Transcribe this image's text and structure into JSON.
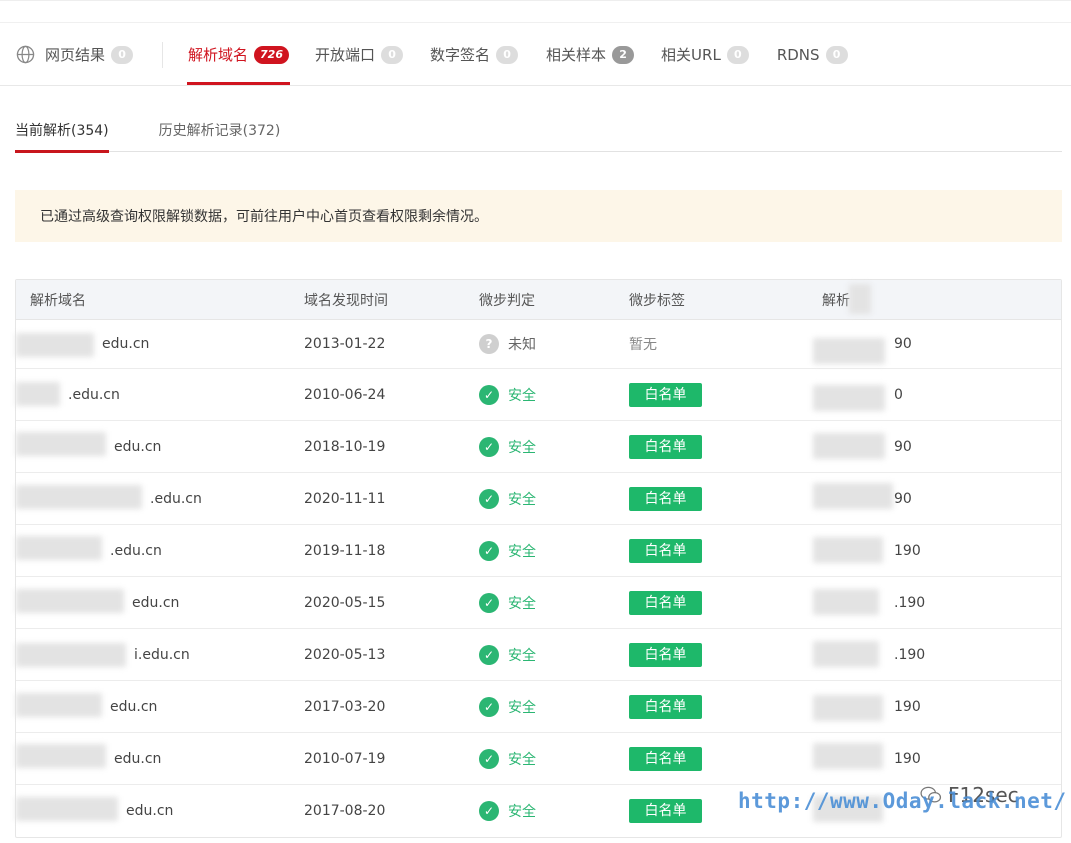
{
  "tabs": [
    {
      "label": "网页结果",
      "count": "0",
      "active": false
    },
    {
      "label": "解析域名",
      "count": "726",
      "active": true
    },
    {
      "label": "开放端口",
      "count": "0",
      "active": false
    },
    {
      "label": "数字签名",
      "count": "0",
      "active": false
    },
    {
      "label": "相关样本",
      "count": "2",
      "active": false
    },
    {
      "label": "相关URL",
      "count": "0",
      "active": false
    },
    {
      "label": "RDNS",
      "count": "0",
      "active": false
    }
  ],
  "subtabs": [
    {
      "label": "当前解析(354)",
      "active": true
    },
    {
      "label": "历史解析记录(372)",
      "active": false
    }
  ],
  "notice": "已通过高级查询权限解锁数据，可前往用户中心首页查看权限剩余情况。",
  "table": {
    "headers": [
      "解析域名",
      "域名发现时间",
      "微步判定",
      "微步标签",
      "解析"
    ],
    "rows": [
      {
        "domain": "edu.cn",
        "date": "2013-01-22",
        "verdict": "未知",
        "verdict_type": "unknown",
        "tag": "暂无",
        "ip": "90"
      },
      {
        "domain": ".edu.cn",
        "date": "2010-06-24",
        "verdict": "安全",
        "verdict_type": "safe",
        "tag": "白名单",
        "ip": "0"
      },
      {
        "domain": "edu.cn",
        "date": "2018-10-19",
        "verdict": "安全",
        "verdict_type": "safe",
        "tag": "白名单",
        "ip": "90"
      },
      {
        "domain": ".edu.cn",
        "date": "2020-11-11",
        "verdict": "安全",
        "verdict_type": "safe",
        "tag": "白名单",
        "ip": "90"
      },
      {
        "domain": ".edu.cn",
        "date": "2019-11-18",
        "verdict": "安全",
        "verdict_type": "safe",
        "tag": "白名单",
        "ip": "190"
      },
      {
        "domain": "edu.cn",
        "date": "2020-05-15",
        "verdict": "安全",
        "verdict_type": "safe",
        "tag": "白名单",
        "ip": ".190"
      },
      {
        "domain": "i.edu.cn",
        "date": "2020-05-13",
        "verdict": "安全",
        "verdict_type": "safe",
        "tag": "白名单",
        "ip": ".190"
      },
      {
        "domain": "edu.cn",
        "date": "2017-03-20",
        "verdict": "安全",
        "verdict_type": "safe",
        "tag": "白名单",
        "ip": "190"
      },
      {
        "domain": "edu.cn",
        "date": "2010-07-19",
        "verdict": "安全",
        "verdict_type": "safe",
        "tag": "白名单",
        "ip": "190"
      },
      {
        "domain": "edu.cn",
        "date": "2017-08-20",
        "verdict": "安全",
        "verdict_type": "safe",
        "tag": "白名单",
        "ip": ""
      }
    ]
  },
  "watermark": {
    "url": "http://www.Oday.lack.net/",
    "brand": "F12sec"
  },
  "icons": {
    "globe": "globe-icon",
    "safe": "check-circle-icon",
    "unknown": "question-circle-icon",
    "wechat": "wechat-icon"
  },
  "colors": {
    "accent": "#d0141f",
    "safe": "#2bb673",
    "whitelist_tag": "#1eb86a",
    "notice_bg": "#fdf6e8"
  }
}
